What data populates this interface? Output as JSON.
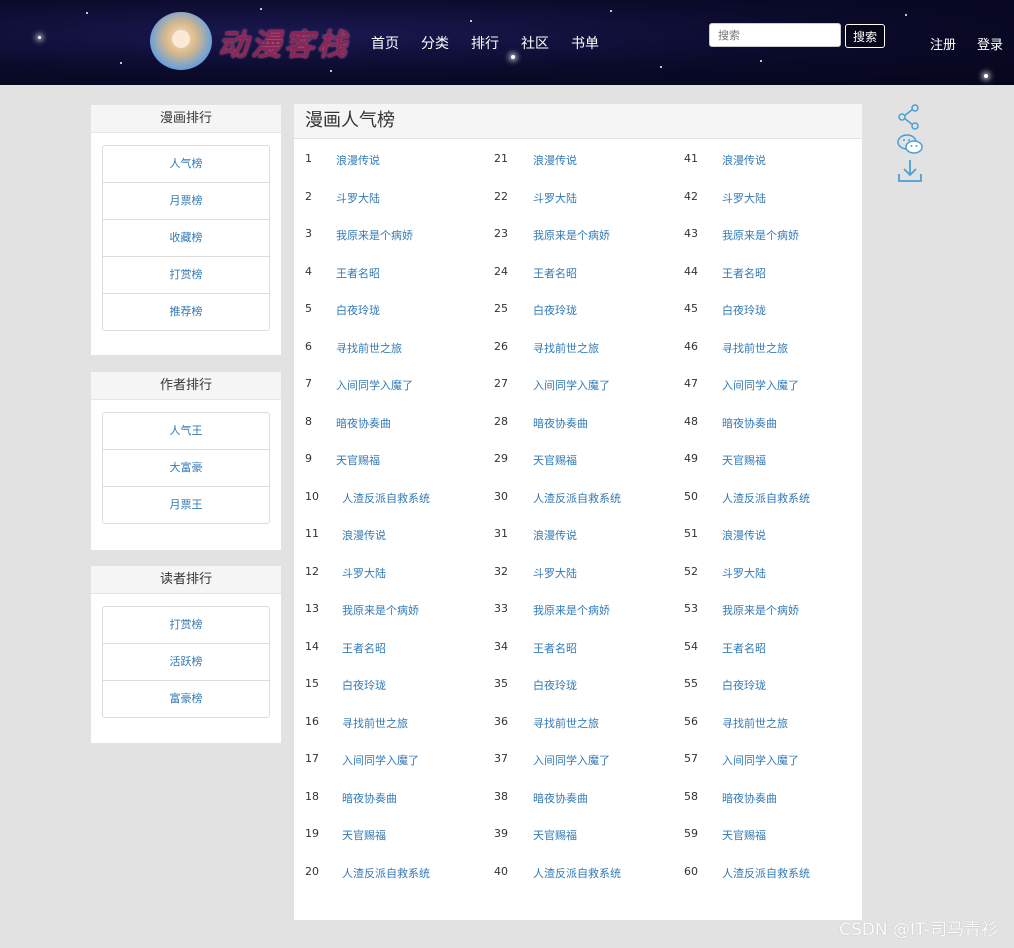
{
  "header": {
    "logo_text": "动漫客栈",
    "nav": [
      "首页",
      "分类",
      "排行",
      "社区",
      "书单"
    ],
    "search_placeholder": "搜索",
    "search_button": "搜索",
    "register": "注册",
    "login": "登录"
  },
  "sidebar": {
    "panels": [
      {
        "title": "漫画排行",
        "items": [
          "人气榜",
          "月票榜",
          "收藏榜",
          "打赏榜",
          "推荐榜"
        ]
      },
      {
        "title": "作者排行",
        "items": [
          "人气王",
          "大富豪",
          "月票王"
        ]
      },
      {
        "title": "读者排行",
        "items": [
          "打赏榜",
          "活跃榜",
          "富豪榜"
        ]
      }
    ]
  },
  "main": {
    "title": "漫画人气榜",
    "columns": [
      [
        {
          "rank": "1",
          "name": "浪漫传说"
        },
        {
          "rank": "2",
          "name": "斗罗大陆"
        },
        {
          "rank": "3",
          "name": "我原来是个病娇"
        },
        {
          "rank": "4",
          "name": "王者名昭"
        },
        {
          "rank": "5",
          "name": "白夜玲珑"
        },
        {
          "rank": "6",
          "name": "寻找前世之旅"
        },
        {
          "rank": "7",
          "name": "入间同学入魔了"
        },
        {
          "rank": "8",
          "name": "暗夜协奏曲"
        },
        {
          "rank": "9",
          "name": "天官赐福"
        },
        {
          "rank": "10",
          "name": "人渣反派自救系统"
        },
        {
          "rank": "11",
          "name": "浪漫传说"
        },
        {
          "rank": "12",
          "name": "斗罗大陆"
        },
        {
          "rank": "13",
          "name": "我原来是个病娇"
        },
        {
          "rank": "14",
          "name": "王者名昭"
        },
        {
          "rank": "15",
          "name": "白夜玲珑"
        },
        {
          "rank": "16",
          "name": "寻找前世之旅"
        },
        {
          "rank": "17",
          "name": "入间同学入魔了"
        },
        {
          "rank": "18",
          "name": "暗夜协奏曲"
        },
        {
          "rank": "19",
          "name": "天官赐福"
        },
        {
          "rank": "20",
          "name": "人渣反派自救系统"
        }
      ],
      [
        {
          "rank": "21",
          "name": "浪漫传说"
        },
        {
          "rank": "22",
          "name": "斗罗大陆"
        },
        {
          "rank": "23",
          "name": "我原来是个病娇"
        },
        {
          "rank": "24",
          "name": "王者名昭"
        },
        {
          "rank": "25",
          "name": "白夜玲珑"
        },
        {
          "rank": "26",
          "name": "寻找前世之旅"
        },
        {
          "rank": "27",
          "name": "入间同学入魔了"
        },
        {
          "rank": "28",
          "name": "暗夜协奏曲"
        },
        {
          "rank": "29",
          "name": "天官赐福"
        },
        {
          "rank": "30",
          "name": "人渣反派自救系统"
        },
        {
          "rank": "31",
          "name": "浪漫传说"
        },
        {
          "rank": "32",
          "name": "斗罗大陆"
        },
        {
          "rank": "33",
          "name": "我原来是个病娇"
        },
        {
          "rank": "34",
          "name": "王者名昭"
        },
        {
          "rank": "35",
          "name": "白夜玲珑"
        },
        {
          "rank": "36",
          "name": "寻找前世之旅"
        },
        {
          "rank": "37",
          "name": "入间同学入魔了"
        },
        {
          "rank": "38",
          "name": "暗夜协奏曲"
        },
        {
          "rank": "39",
          "name": "天官赐福"
        },
        {
          "rank": "40",
          "name": "人渣反派自救系统"
        }
      ],
      [
        {
          "rank": "41",
          "name": "浪漫传说"
        },
        {
          "rank": "42",
          "name": "斗罗大陆"
        },
        {
          "rank": "43",
          "name": "我原来是个病娇"
        },
        {
          "rank": "44",
          "name": "王者名昭"
        },
        {
          "rank": "45",
          "name": "白夜玲珑"
        },
        {
          "rank": "46",
          "name": "寻找前世之旅"
        },
        {
          "rank": "47",
          "name": "入间同学入魔了"
        },
        {
          "rank": "48",
          "name": "暗夜协奏曲"
        },
        {
          "rank": "49",
          "name": "天官赐福"
        },
        {
          "rank": "50",
          "name": "人渣反派自救系统"
        },
        {
          "rank": "51",
          "name": "浪漫传说"
        },
        {
          "rank": "52",
          "name": "斗罗大陆"
        },
        {
          "rank": "53",
          "name": "我原来是个病娇"
        },
        {
          "rank": "54",
          "name": "王者名昭"
        },
        {
          "rank": "55",
          "name": "白夜玲珑"
        },
        {
          "rank": "56",
          "name": "寻找前世之旅"
        },
        {
          "rank": "57",
          "name": "入间同学入魔了"
        },
        {
          "rank": "58",
          "name": "暗夜协奏曲"
        },
        {
          "rank": "59",
          "name": "天官赐福"
        },
        {
          "rank": "60",
          "name": "人渣反派自救系统"
        }
      ]
    ]
  },
  "side_icons": [
    "share-icon",
    "wechat-icon",
    "download-icon"
  ],
  "watermark": "CSDN @IT-司马青衫",
  "colors": {
    "link": "#337ab7",
    "header_bg": "#05061a",
    "logo": "#8a2555"
  }
}
